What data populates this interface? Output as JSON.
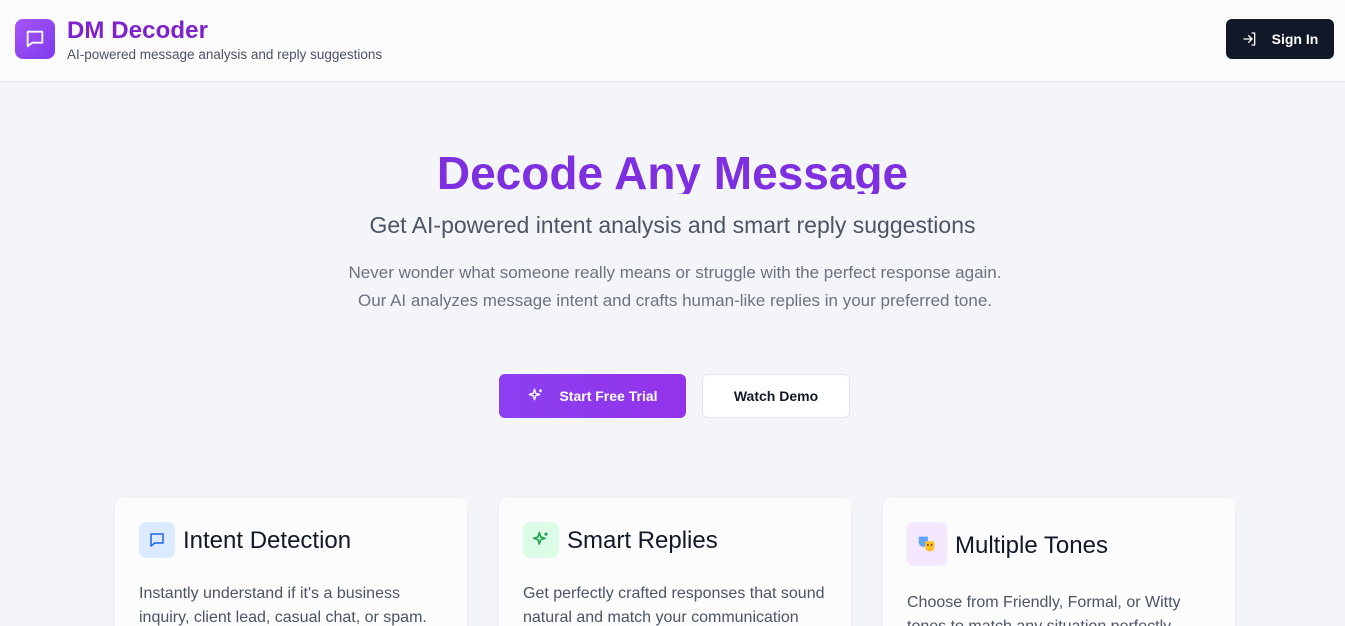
{
  "header": {
    "title": "DM Decoder",
    "subtitle": "AI-powered message analysis and reply suggestions",
    "sign_in": "Sign In"
  },
  "hero": {
    "title": "Decode Any Message",
    "subtitle": "Get AI-powered intent analysis and smart reply suggestions",
    "description": "Never wonder what someone really means or struggle with the perfect response again. Our AI analyzes message intent and crafts human-like replies in your preferred tone.",
    "primary_button": "Start Free Trial",
    "secondary_button": "Watch Demo"
  },
  "features": [
    {
      "title": "Intent Detection",
      "text": "Instantly understand if it's a business inquiry, client lead, casual chat, or spam.",
      "icon": "message-square-icon",
      "icon_bg": "#dbeafe",
      "icon_color": "#2563eb"
    },
    {
      "title": "Smart Replies",
      "text": "Get perfectly crafted responses that sound natural and match your communication style.",
      "icon": "sparkles-icon",
      "icon_bg": "#dcfce7",
      "icon_color": "#16a34a"
    },
    {
      "title": "Multiple Tones",
      "text": "Choose from Friendly, Formal, or Witty tones to match any situation perfectly.",
      "icon": "theater-masks-icon",
      "icon_bg": "#f3e8ff",
      "icon_color": "#9333ea"
    }
  ],
  "colors": {
    "brand": "#7e22ce",
    "primary_button": "#8b3ff0",
    "sign_in_bg": "#111827"
  }
}
